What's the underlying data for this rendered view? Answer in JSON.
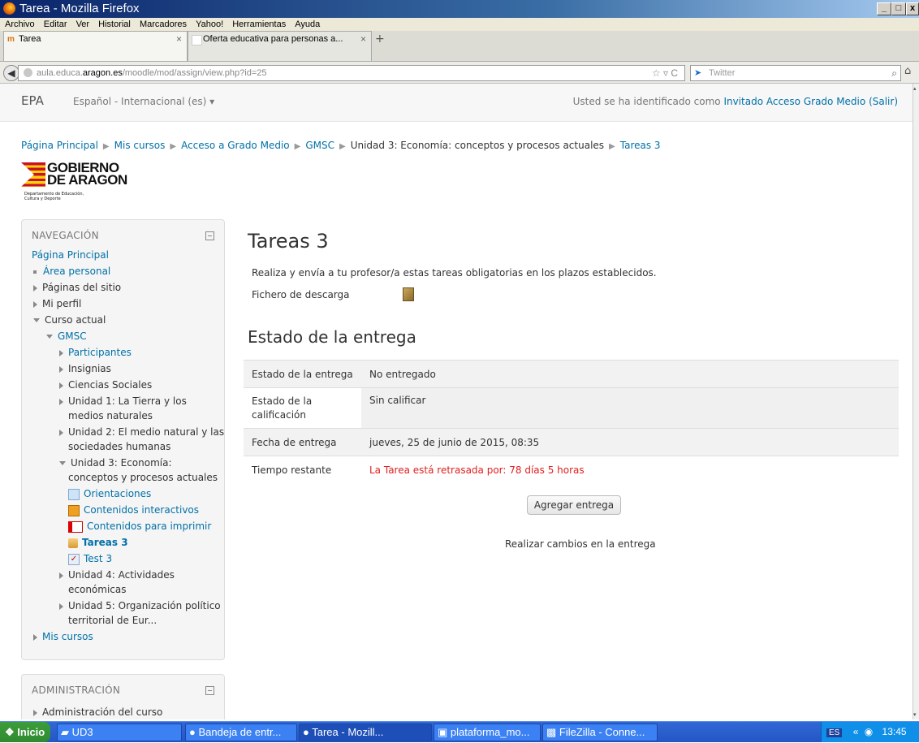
{
  "window": {
    "title": "Tarea - Mozilla Firefox",
    "min": "_",
    "max": "□",
    "close": "x"
  },
  "menubar": [
    "Archivo",
    "Editar",
    "Ver",
    "Historial",
    "Marcadores",
    "Yahoo!",
    "Herramientas",
    "Ayuda"
  ],
  "tabs": [
    {
      "label": "Tarea",
      "close": "×"
    },
    {
      "label": "Oferta educativa para personas a...",
      "close": "×"
    }
  ],
  "newtab": "+",
  "urlbar": {
    "prefix": "aula.educa.",
    "domain": "aragon.es",
    "path": "/moodle/mod/assign/view.php?id=25"
  },
  "search": {
    "placeholder": "Twitter"
  },
  "topnav": {
    "brand": "EPA",
    "language": "Español - Internacional (es)",
    "login_prefix": "Usted se ha identificado como ",
    "login_user": "Invitado Acceso Grado Medio",
    "logout": "(Salir)"
  },
  "breadcrumb": [
    "Página Principal",
    "Mis cursos",
    "Acceso a Grado Medio",
    "GMSC",
    "Unidad 3: Economía: conceptos y procesos actuales",
    "Tareas 3"
  ],
  "logo": {
    "line1": "GOBIERNO",
    "line2": "DE ARAGON",
    "sub": "Departamento de Educación, Cultura y Deporte"
  },
  "navigation": {
    "title": "NAVEGACIÓN",
    "home": "Página Principal",
    "area": "Área personal",
    "pages": "Páginas del sitio",
    "profile": "Mi perfil",
    "current": "Curso actual",
    "course": "GMSC",
    "participants": "Participantes",
    "badges": "Insignias",
    "social": "Ciencias Sociales",
    "u1a": "Unidad 1: La Tierra y los",
    "u1b": "medios naturales",
    "u2a": "Unidad 2: El medio natural y las",
    "u2b": "sociedades humanas",
    "u3a": "Unidad 3: Economía:",
    "u3b": "conceptos y procesos actuales",
    "orient": "Orientaciones",
    "interact": "Contenidos interactivos",
    "print": "Contenidos para imprimir",
    "tareas": "Tareas 3",
    "test": "Test 3",
    "u4a": "Unidad 4: Actividades",
    "u4b": "económicas",
    "u5a": "Unidad 5: Organización político",
    "u5b": "territorial de Eur...",
    "mycourses": "Mis cursos"
  },
  "admin": {
    "title": "ADMINISTRACIÓN",
    "course_admin": "Administración del curso"
  },
  "main": {
    "title": "Tareas 3",
    "intro": "Realiza y envía a tu profesor/a estas tareas obligatorias en los plazos establecidos.",
    "file_label": "Fichero de descarga",
    "status_heading": "Estado de la entrega",
    "rows": [
      {
        "label": "Estado de la entrega",
        "value": "No entregado"
      },
      {
        "label": "Estado de la calificación",
        "value": "Sin calificar"
      },
      {
        "label": "Fecha de entrega",
        "value": "jueves, 25 de junio de 2015, 08:35"
      },
      {
        "label": "Tiempo restante",
        "value": "La Tarea está retrasada por: 78 días 5 horas"
      }
    ],
    "add_button": "Agregar entrega",
    "changes": "Realizar cambios en la entrega"
  },
  "taskbar": {
    "start": "Inicio",
    "items": [
      "UD3",
      "Bandeja de entr...",
      "Tarea - Mozill...",
      "plataforma_mo...",
      "FileZilla - Conne..."
    ],
    "lang": "ES",
    "clock": "13:45"
  },
  "colors": {
    "link": "#0070a8",
    "late": "#e02020",
    "taskbar": "#2456c4"
  }
}
